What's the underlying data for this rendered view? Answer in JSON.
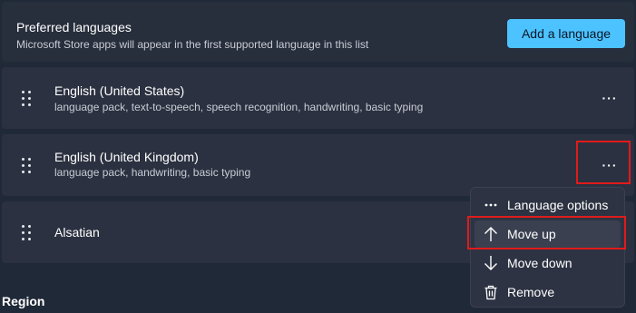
{
  "header": {
    "title": "Preferred languages",
    "subtitle": "Microsoft Store apps will appear in the first supported language in this list",
    "add_button": "Add a language"
  },
  "languages": [
    {
      "name": "English (United States)",
      "features": "language pack, text-to-speech, speech recognition, handwriting, basic typing"
    },
    {
      "name": "English (United Kingdom)",
      "features": "language pack, handwriting, basic typing"
    },
    {
      "name": "Alsatian",
      "features": ""
    }
  ],
  "more_glyph": "···",
  "context_menu": {
    "items": [
      {
        "label": "Language options",
        "icon": "more-icon"
      },
      {
        "label": "Move up",
        "icon": "arrow-up-icon"
      },
      {
        "label": "Move down",
        "icon": "arrow-down-icon"
      },
      {
        "label": "Remove",
        "icon": "trash-icon"
      }
    ]
  },
  "section_next": "Region",
  "colors": {
    "accent": "#4cc2ff",
    "highlight": "#e01b1b",
    "background": "#202938",
    "card": "#2b3140"
  }
}
